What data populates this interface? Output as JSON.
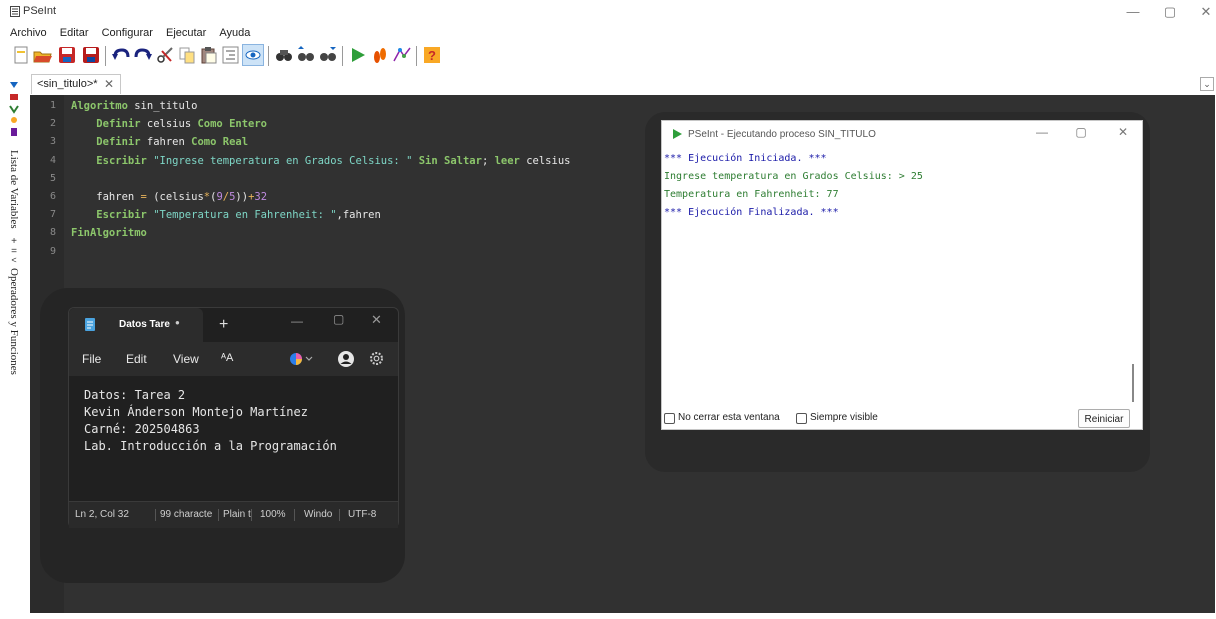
{
  "window": {
    "title": "PSeInt",
    "controls": [
      "—",
      "▢",
      "✕"
    ]
  },
  "menubar": [
    "Archivo",
    "Editar",
    "Configurar",
    "Ejecutar",
    "Ayuda"
  ],
  "toolbar_icons": [
    "new-file-icon",
    "open-file-icon",
    "save-icon",
    "save-as-icon",
    "undo-icon",
    "redo-icon",
    "cut-icon",
    "copy-icon",
    "paste-icon",
    "indent-icon",
    "watch-icon",
    "find-icon",
    "find-previous-icon",
    "find-next-icon",
    "run-icon",
    "step-icon",
    "flowchart-icon",
    "help-icon"
  ],
  "editor_tab": {
    "label": "<sin_titulo>*",
    "close": "✕"
  },
  "side_panels": {
    "variables": "Lista de Variables",
    "operators": "Operadores y Funciones"
  },
  "code": {
    "line_numbers": [
      "1",
      "2",
      "3",
      "4",
      "5",
      "6",
      "7",
      "8",
      "9"
    ],
    "lines": [
      [
        {
          "t": "Algoritmo",
          "c": "kw"
        },
        {
          "t": " sin_titulo",
          "c": ""
        }
      ],
      [
        {
          "t": "    ",
          "c": ""
        },
        {
          "t": "Definir",
          "c": "kw"
        },
        {
          "t": " celsius ",
          "c": ""
        },
        {
          "t": "Como Entero",
          "c": "kw"
        }
      ],
      [
        {
          "t": "    ",
          "c": ""
        },
        {
          "t": "Definir",
          "c": "kw"
        },
        {
          "t": " fahren ",
          "c": ""
        },
        {
          "t": "Como Real",
          "c": "kw"
        }
      ],
      [
        {
          "t": "    ",
          "c": ""
        },
        {
          "t": "Escribir",
          "c": "kw"
        },
        {
          "t": " ",
          "c": ""
        },
        {
          "t": "\"Ingrese temperatura en Grados Celsius: \"",
          "c": "str"
        },
        {
          "t": " ",
          "c": ""
        },
        {
          "t": "Sin Saltar",
          "c": "kw"
        },
        {
          "t": "; ",
          "c": ""
        },
        {
          "t": "leer",
          "c": "kw"
        },
        {
          "t": " celsius",
          "c": ""
        }
      ],
      [],
      [
        {
          "t": "    fahren ",
          "c": ""
        },
        {
          "t": "=",
          "c": "op"
        },
        {
          "t": " (celsius",
          "c": ""
        },
        {
          "t": "*",
          "c": "op"
        },
        {
          "t": "(",
          "c": ""
        },
        {
          "t": "9",
          "c": "num"
        },
        {
          "t": "/",
          "c": "op"
        },
        {
          "t": "5",
          "c": "num"
        },
        {
          "t": "))",
          "c": ""
        },
        {
          "t": "+",
          "c": "op"
        },
        {
          "t": "32",
          "c": "num"
        }
      ],
      [
        {
          "t": "    ",
          "c": ""
        },
        {
          "t": "Escribir",
          "c": "kw"
        },
        {
          "t": " ",
          "c": ""
        },
        {
          "t": "\"Temperatura en Fahrenheit: \"",
          "c": "str"
        },
        {
          "t": ",fahren",
          "c": ""
        }
      ],
      [
        {
          "t": "FinAlgoritmo",
          "c": "kw"
        }
      ],
      []
    ]
  },
  "run_window": {
    "title": "PSeInt - Ejecutando proceso SIN_TITULO",
    "output": [
      {
        "text": "*** Ejecución Iniciada. ***",
        "color": "#1a1aa8"
      },
      {
        "text": "Ingrese temperatura en Grados Celsius: > 25",
        "color": "#2e7d32"
      },
      {
        "text": "Temperatura en Fahrenheit: 77",
        "color": "#2e7d32"
      },
      {
        "text": "*** Ejecución Finalizada. ***",
        "color": "#1a1aa8"
      }
    ],
    "checkbox_keep_open": "No cerrar esta ventana",
    "checkbox_always_visible": "Siempre visible",
    "restart_button": "Reiniciar"
  },
  "notepad": {
    "tab_title": "Datos Tare",
    "tab_dot": "●",
    "add_tab": "+",
    "menus": [
      "File",
      "Edit",
      "View"
    ],
    "text_size_icon": "ÂA",
    "content": [
      "Datos: Tarea 2",
      "Kevin Ánderson Montejo Martínez",
      "Carné: 202504863",
      "Lab. Introducción a la Programación"
    ],
    "status": [
      "Ln 2, Col 32",
      "99 characte",
      "Plain t",
      "100%",
      "Windo",
      "UTF-8"
    ]
  }
}
